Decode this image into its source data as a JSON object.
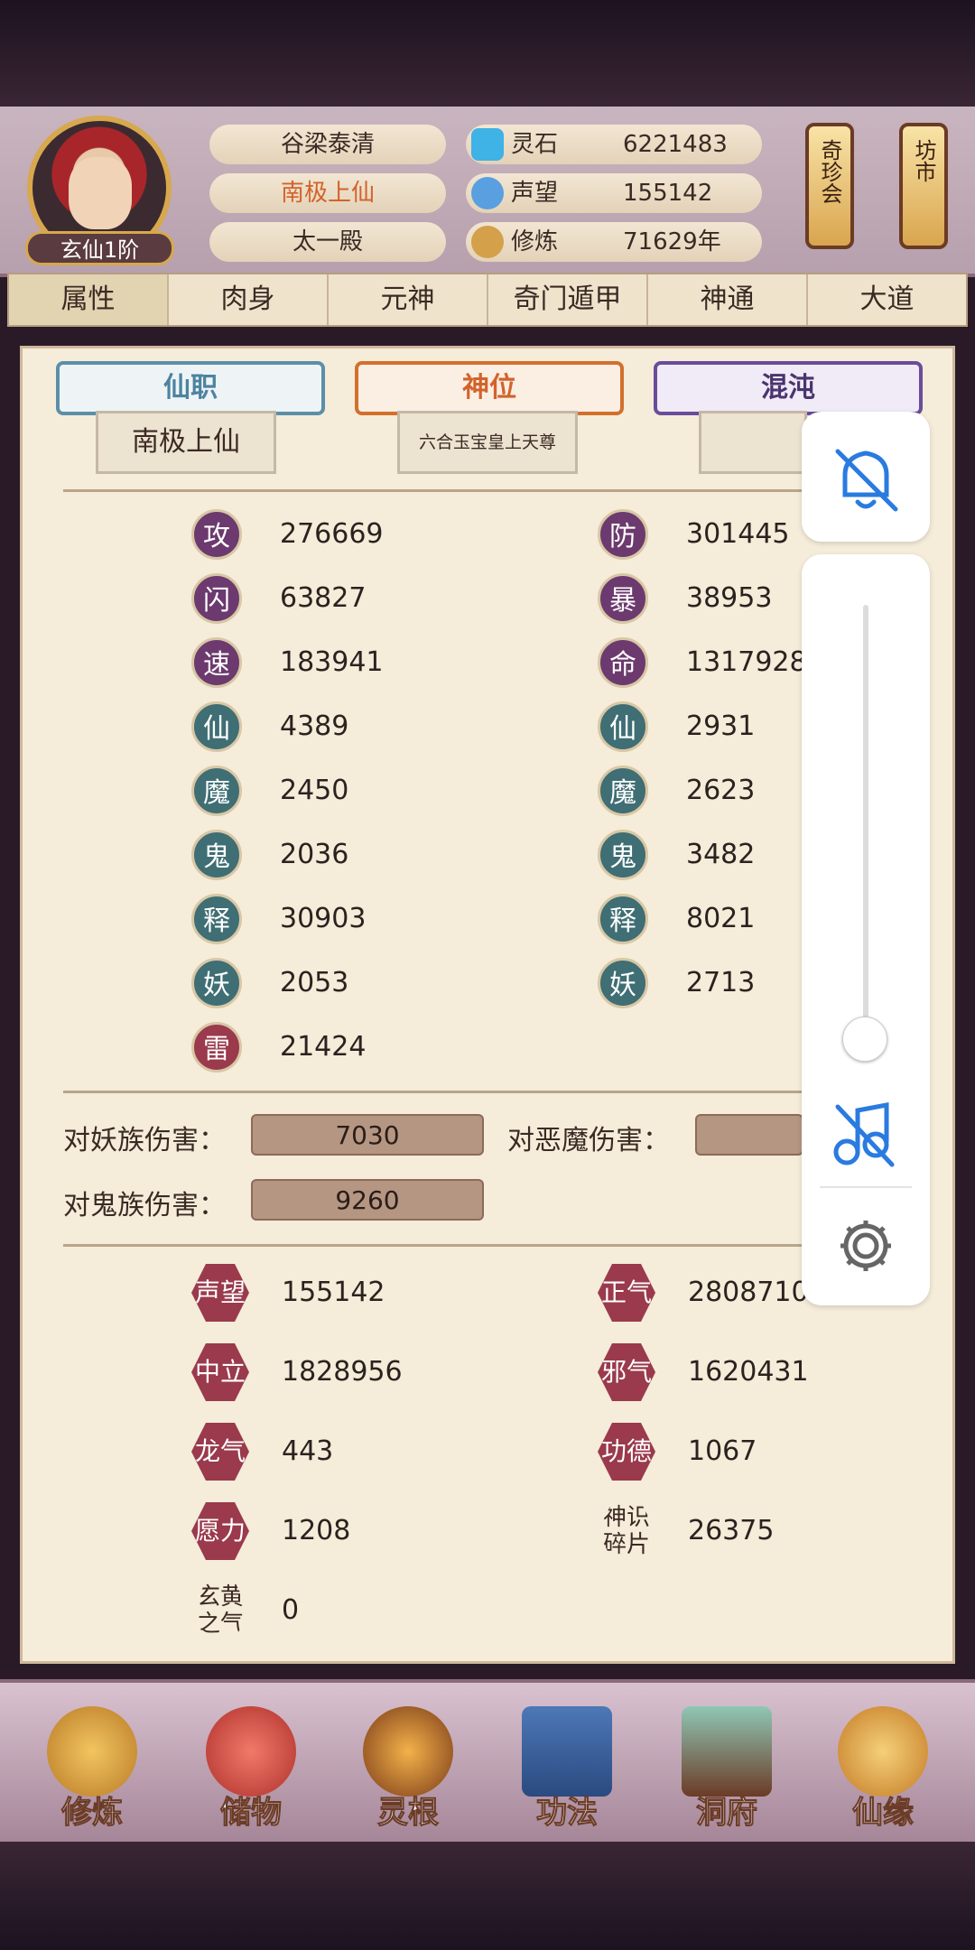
{
  "player": {
    "rank_badge": "玄仙1阶",
    "names": [
      "谷梁泰清",
      "南极上仙",
      "太一殿"
    ]
  },
  "resources": [
    {
      "label": "灵石",
      "value": "6221483",
      "icon": "spirit-stone-icon"
    },
    {
      "label": "声望",
      "value": "155142",
      "icon": "reputation-crystal-icon"
    },
    {
      "label": "修炼",
      "value": "71629年",
      "icon": "meditation-icon"
    }
  ],
  "lanterns": [
    "奇珍会",
    "坊市"
  ],
  "tabs": [
    "属性",
    "肉身",
    "元神",
    "奇门遁甲",
    "神通",
    "大道"
  ],
  "banners": [
    {
      "title": "仙职",
      "sub": "南极上仙",
      "color": "#5b8fa8"
    },
    {
      "title": "神位",
      "sub": "六合玉宝皇上天尊",
      "color": "#d2702d"
    },
    {
      "title": "混沌",
      "sub": "",
      "color": "#6a4c9a"
    }
  ],
  "stats_left": [
    {
      "badge": "攻",
      "value": "276669"
    },
    {
      "badge": "闪",
      "value": "63827"
    },
    {
      "badge": "速",
      "value": "183941"
    },
    {
      "badge": "仙",
      "value": "4389"
    },
    {
      "badge": "魔",
      "value": "2450"
    },
    {
      "badge": "鬼",
      "value": "2036"
    },
    {
      "badge": "释",
      "value": "30903"
    },
    {
      "badge": "妖",
      "value": "2053"
    },
    {
      "badge": "雷",
      "value": "21424"
    }
  ],
  "stats_right": [
    {
      "badge": "防",
      "value": "301445"
    },
    {
      "badge": "暴",
      "value": "38953"
    },
    {
      "badge": "命",
      "value": "1317928"
    },
    {
      "badge": "仙",
      "value": "2931"
    },
    {
      "badge": "魔",
      "value": "2623"
    },
    {
      "badge": "鬼",
      "value": "3482"
    },
    {
      "badge": "释",
      "value": "8021"
    },
    {
      "badge": "妖",
      "value": "2713"
    }
  ],
  "damage": [
    {
      "label": "对妖族伤害：",
      "value": "7030"
    },
    {
      "label": "对恶魔伤害：",
      "value": ""
    },
    {
      "label": "对鬼族伤害：",
      "value": "9260"
    }
  ],
  "reputation_left": [
    {
      "badge": "声望",
      "value": "155142"
    },
    {
      "badge": "中立",
      "value": "1828956"
    },
    {
      "badge": "龙气",
      "value": "443"
    },
    {
      "badge": "愿力",
      "value": "1208"
    },
    {
      "badge": "玄黄之气",
      "value": "0"
    }
  ],
  "reputation_right": [
    {
      "badge": "正气",
      "value": "2808710"
    },
    {
      "badge": "邪气",
      "value": "1620431"
    },
    {
      "badge": "功德",
      "value": "1067"
    },
    {
      "badge": "神识碎片",
      "value": "26375"
    }
  ],
  "bottom_nav": [
    "修炼",
    "储物",
    "灵根",
    "功法",
    "洞府",
    "仙缘"
  ],
  "system_panel": {
    "icons": [
      "bell-off-icon",
      "music-off-icon",
      "gear-icon"
    ],
    "volume_level": 0
  }
}
